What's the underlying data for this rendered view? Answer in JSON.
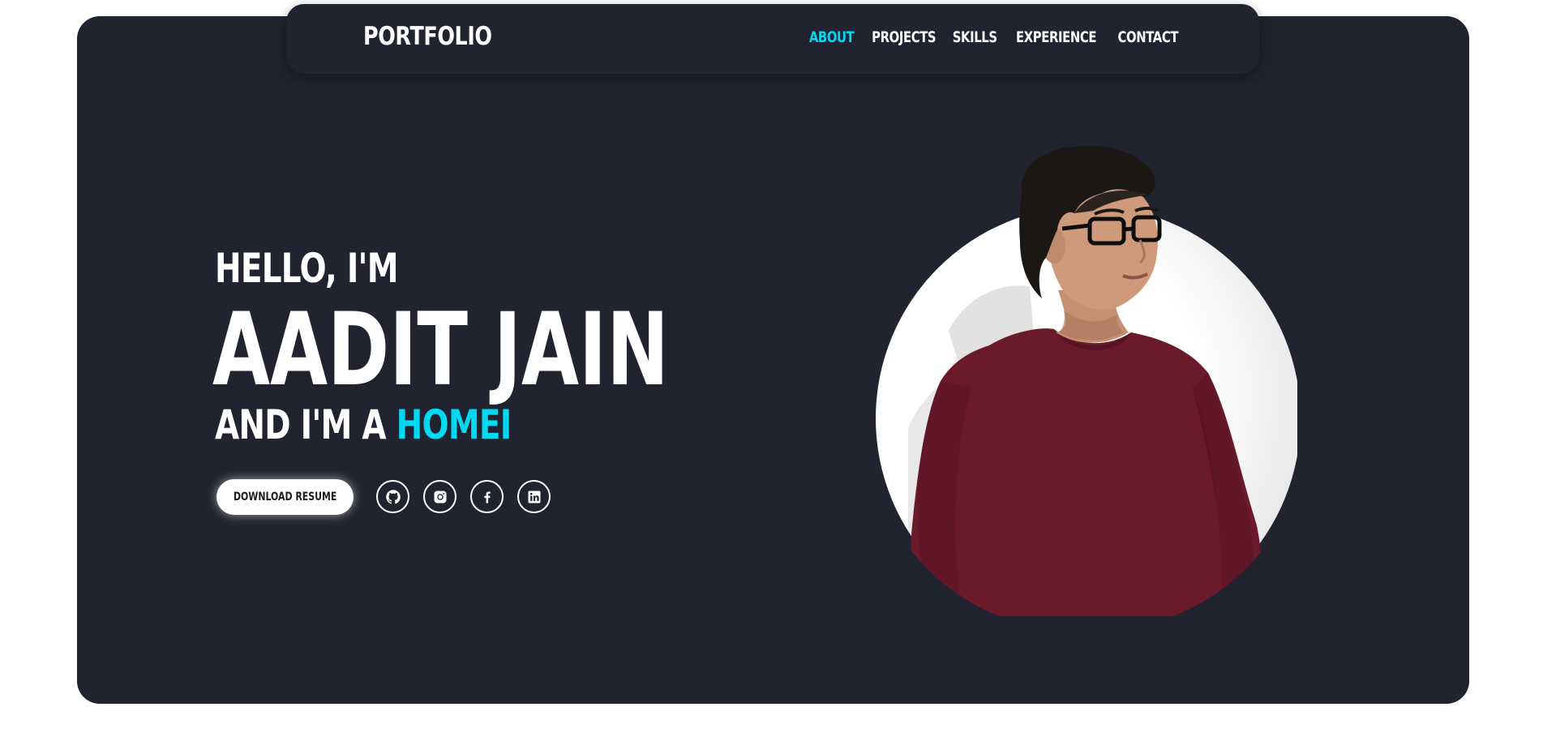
{
  "navbar": {
    "logo": "PORTFOLIO",
    "links": [
      {
        "label": "ABOUT",
        "active": true
      },
      {
        "label": "PROJECTS",
        "active": false
      },
      {
        "label": "SKILLS",
        "active": false
      },
      {
        "label": "EXPERIENCE",
        "active": false
      },
      {
        "label": "CONTACT",
        "active": false
      }
    ]
  },
  "hero": {
    "greeting": "HELLO, I'M",
    "name": "AADIT JAIN",
    "role_prefix": "AND I'M A ",
    "role_highlight": "HOMEI",
    "resume_button": "DOWNLOAD RESUME",
    "socials": [
      {
        "icon": "github-icon"
      },
      {
        "icon": "instagram-icon"
      },
      {
        "icon": "facebook-icon"
      },
      {
        "icon": "linkedin-icon"
      }
    ]
  },
  "colors": {
    "background": "#212330",
    "accent": "#00d9f0",
    "text": "#ffffff",
    "shirt": "#6b1a2a"
  }
}
